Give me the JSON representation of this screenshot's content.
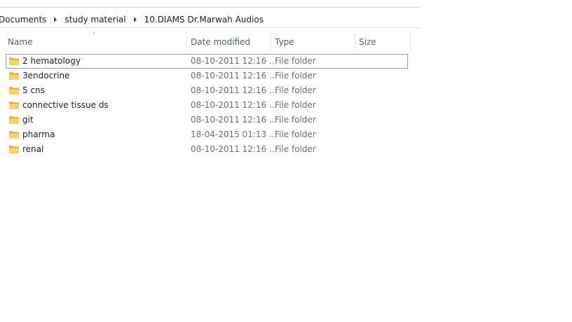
{
  "breadcrumb": {
    "items": [
      "Documents",
      "study material",
      "10.DIAMS Dr.Marwah Audios"
    ]
  },
  "columns": {
    "name": "Name",
    "date_modified": "Date modified",
    "type": "Type",
    "size": "Size",
    "sort_indicator": "˄"
  },
  "files": [
    {
      "name": "2 hematology",
      "date": "08-10-2011 12:16 ...",
      "type": "File folder",
      "icon": "folder-icon",
      "selected": true
    },
    {
      "name": "3endocrine",
      "date": "08-10-2011 12:16 ...",
      "type": "File folder",
      "icon": "folder-icon"
    },
    {
      "name": "5 cns",
      "date": "08-10-2011 12:16 ...",
      "type": "File folder",
      "icon": "folder-icon"
    },
    {
      "name": "connective tissue ds",
      "date": "08-10-2011 12:16 ...",
      "type": "File folder",
      "icon": "folder-icon"
    },
    {
      "name": "git",
      "date": "08-10-2011 12:16 ...",
      "type": "File folder",
      "icon": "folder-icon"
    },
    {
      "name": "pharma",
      "date": "18-04-2015 01:13 ...",
      "type": "File folder",
      "icon": "folder-icon"
    },
    {
      "name": "renal",
      "date": "08-10-2011 12:16 ...",
      "type": "File folder",
      "icon": "folder-icon"
    }
  ],
  "colors": {
    "header_text": "#4c607a",
    "selection_border": "#7da2ce",
    "folder_yellow": "#e8b93f"
  }
}
